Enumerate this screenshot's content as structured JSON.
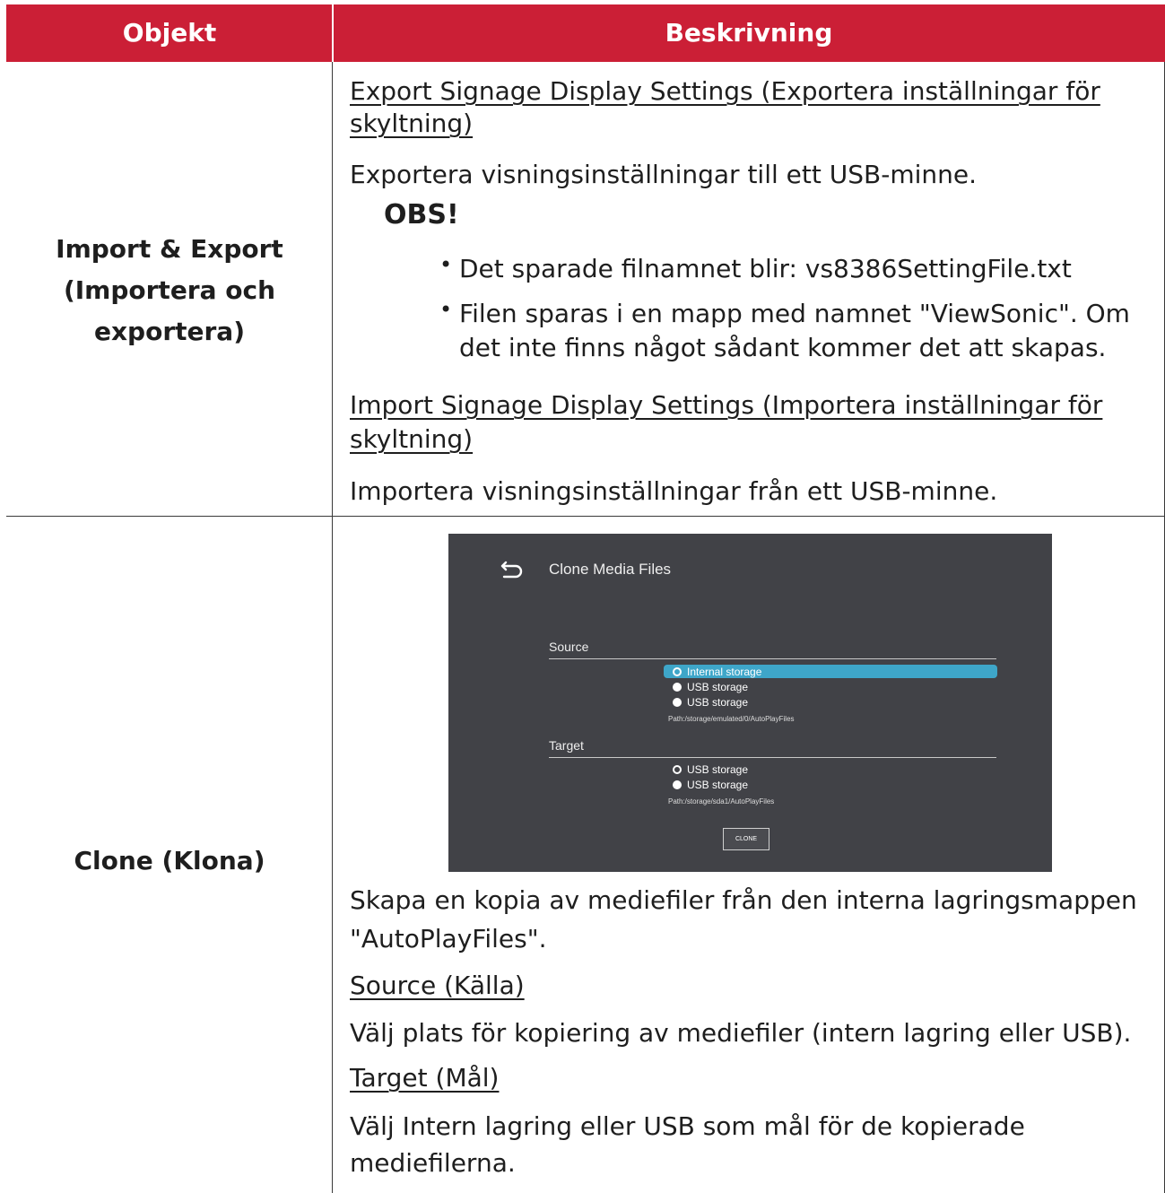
{
  "header": {
    "col1": "Objekt",
    "col2": "Beskrivning"
  },
  "rows": [
    {
      "label": [
        "Import & Export",
        "(Importera och",
        "exportera)"
      ],
      "export_title_l1": "Export Signage Display Settings (Exportera inställningar för",
      "export_title_l2": "skyltning)",
      "export_desc": "Exportera visningsinställningar till ett USB-minne.",
      "note_label": "OBS!",
      "bullets": [
        "Det sparade filnamnet blir: vs8386SettingFile.txt",
        "Filen sparas i en mapp med namnet \"ViewSonic\". Om",
        "det inte finns något sådant kommer det att skapas."
      ],
      "import_title_l1": "Import Signage Display Settings (Importera inställningar för",
      "import_title_l2": "skyltning)",
      "import_desc": "Importera visningsinställningar från ett USB-minne."
    },
    {
      "label": "Clone (Klona)",
      "desc_l1": "Skapa en kopia av mediefiler från den interna lagringsmappen",
      "desc_l2": "\"AutoPlayFiles\".",
      "source_title": "Source (Källa)",
      "source_desc": "Välj plats för kopiering av mediefiler (intern lagring eller USB).",
      "target_title": "Target (Mål)",
      "target_desc_l1": "Välj Intern lagring eller USB som mål för de kopierade",
      "target_desc_l2": "mediefilerna."
    }
  ],
  "screenshot": {
    "title": "Clone Media Files",
    "back_icon": "back-arrow-icon",
    "source_label": "Source",
    "source_options": [
      "Internal storage",
      "USB storage",
      "USB storage"
    ],
    "source_selected": 0,
    "source_path": "Path:/storage/emulated/0/AutoPlayFiles",
    "target_label": "Target",
    "target_options": [
      "USB storage",
      "USB storage"
    ],
    "target_selected": 0,
    "target_path": "Path:/storage/sda1/AutoPlayFiles",
    "button_label": "CLONE",
    "highlight_color": "#3ea6c9",
    "background_color": "#414247"
  },
  "colors": {
    "header_bg": "#cb1f36",
    "header_text": "#ffffff",
    "body_text": "#1e1e1e"
  }
}
